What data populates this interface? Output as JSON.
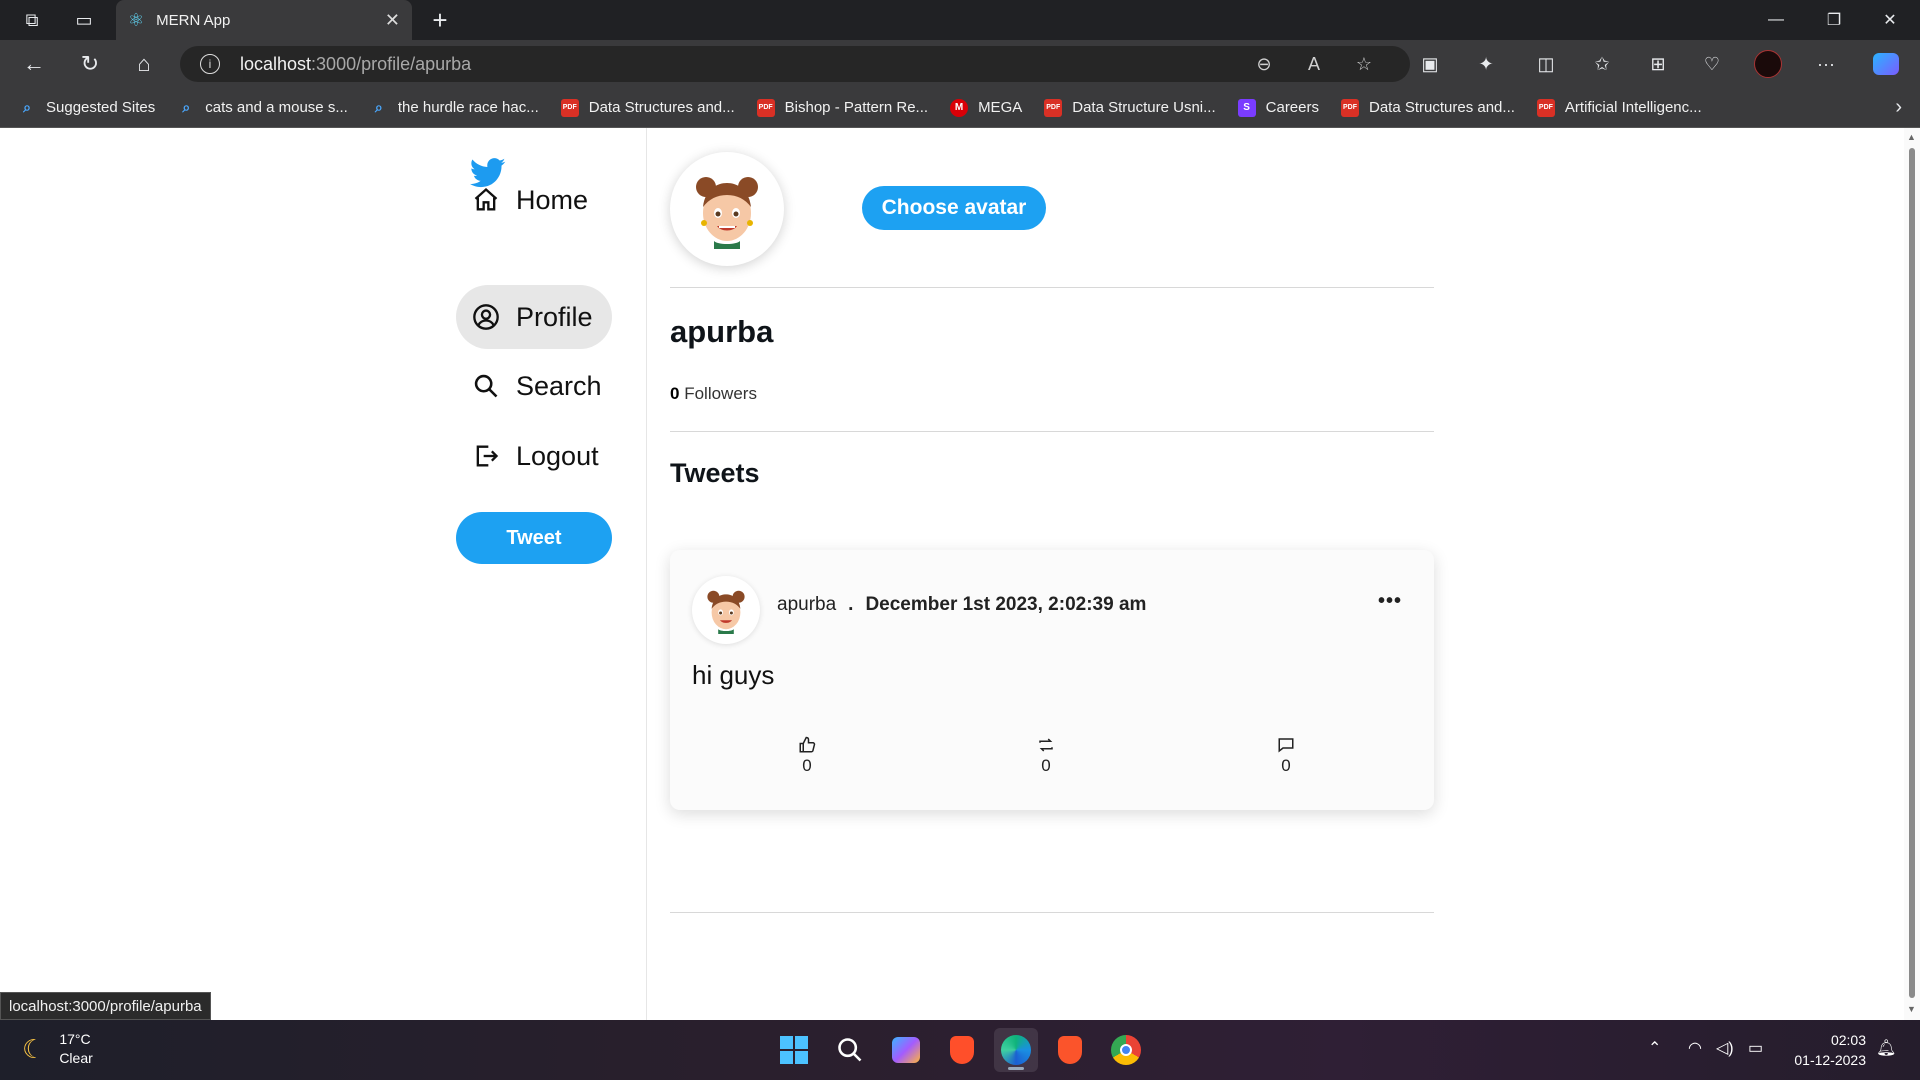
{
  "browser": {
    "tab_title": "MERN App",
    "url_host": "localhost",
    "url_path": ":3000/profile/apurba",
    "bookmarks": [
      {
        "label": "Suggested Sites",
        "icon": "search-icon"
      },
      {
        "label": "cats and a mouse s...",
        "icon": "search-icon"
      },
      {
        "label": "the hurdle race hac...",
        "icon": "search-icon"
      },
      {
        "label": "Data Structures and...",
        "icon": "pdf-icon"
      },
      {
        "label": "Bishop - Pattern Re...",
        "icon": "pdf-icon"
      },
      {
        "label": "MEGA",
        "icon": "mega-icon"
      },
      {
        "label": "Data Structure Usni...",
        "icon": "pdf-icon"
      },
      {
        "label": "Careers",
        "icon": "s-icon"
      },
      {
        "label": "Data Structures and...",
        "icon": "pdf-icon"
      },
      {
        "label": "Artificial Intelligenc...",
        "icon": "pdf-icon"
      }
    ],
    "status_url": "localhost:3000/profile/apurba"
  },
  "sidebar": {
    "items": [
      {
        "label": "Home",
        "icon": "home-icon"
      },
      {
        "label": "Profile",
        "icon": "profile-icon"
      },
      {
        "label": "Search",
        "icon": "search-icon"
      },
      {
        "label": "Logout",
        "icon": "logout-icon"
      }
    ],
    "tweet_label": "Tweet"
  },
  "profile": {
    "choose_avatar_label": "Choose avatar",
    "username": "apurba",
    "followers_count": "0",
    "followers_label": "Followers",
    "tweets_title": "Tweets"
  },
  "tweet": {
    "author": "apurba",
    "separator": ".",
    "date": "December 1st 2023, 2:02:39 am",
    "text": "hi guys",
    "likes": "0",
    "retweets": "0",
    "comments": "0"
  },
  "taskbar": {
    "temperature": "17°C",
    "weather": "Clear",
    "time": "02:03",
    "date": "01-12-2023"
  },
  "colors": {
    "accent": "#1da1f2",
    "active_nav_bg": "#e7e7e7"
  }
}
